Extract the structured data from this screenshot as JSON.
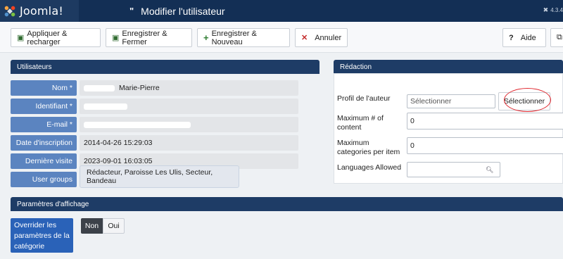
{
  "header": {
    "logo_text": "Joomla!",
    "title_icon": "\"",
    "page_title": "Modifier l'utilisateur",
    "version": "4.3.4"
  },
  "toolbar": {
    "apply_label": "Appliquer & recharger",
    "save_close_label": "Enregistrer & Fermer",
    "save_new_label": "Enregistrer & Nouveau",
    "cancel_label": "Annuler",
    "help_label": "Aide"
  },
  "users": {
    "section_title": "Utilisateurs",
    "fields": [
      {
        "label": "Nom *",
        "value": "Marie-Pierre"
      },
      {
        "label": "Identifiant *",
        "value": ""
      },
      {
        "label": "E-mail *",
        "value": ""
      },
      {
        "label": "Date d'inscription",
        "value": "2014-04-26 15:29:03"
      },
      {
        "label": "Dernière visite",
        "value": "2023-09-01 16:03:05"
      },
      {
        "label": "User groups",
        "value": "Rédacteur, Paroisse Les Ulis, Secteur, Bandeau"
      }
    ]
  },
  "redaction": {
    "section_title": "Rédaction",
    "author_profile_label": "Profil de l'auteur",
    "author_profile_placeholder": "Sélectionner",
    "select_button": "Sélectionner",
    "max_content_label": "Maximum # of content",
    "max_content_value": "0",
    "max_categories_label": "Maximum categories per item",
    "max_categories_value": "0",
    "languages_label": "Languages Allowed"
  },
  "display": {
    "section_title": "Paramètres d'affichage",
    "override_label": "Overrider les paramètres de la catégorie",
    "toggle_no": "Non",
    "toggle_yes": "Oui",
    "selected": "Non"
  },
  "colors": {
    "header_bg": "#132f55",
    "section_bar": "#1e3c66",
    "field_label": "#5b84c0",
    "annotation_circle": "#e0282f"
  }
}
